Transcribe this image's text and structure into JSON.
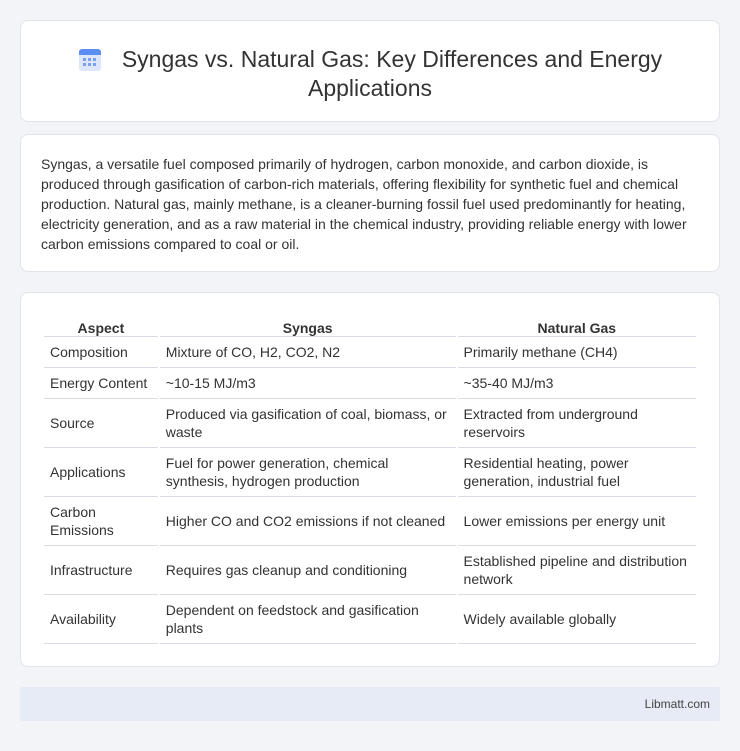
{
  "header": {
    "icon": "calendar-icon",
    "title": "Syngas vs. Natural Gas: Key Differences and Energy Applications"
  },
  "summary": {
    "text": "Syngas, a versatile fuel composed primarily of hydrogen, carbon monoxide, and carbon dioxide, is produced through gasification of carbon-rich materials, offering flexibility for synthetic fuel and chemical production. Natural gas, mainly methane, is a cleaner-burning fossil fuel used predominantly for heating, electricity generation, and as a raw material in the chemical industry, providing reliable energy with lower carbon emissions compared to coal or oil."
  },
  "table": {
    "headers": [
      "Aspect",
      "Syngas",
      "Natural Gas"
    ],
    "rows": [
      [
        "Composition",
        "Mixture of CO, H2, CO2, N2",
        "Primarily methane (CH4)"
      ],
      [
        "Energy Content",
        "~10-15 MJ/m3",
        "~35-40 MJ/m3"
      ],
      [
        "Source",
        "Produced via gasification of coal, biomass, or waste",
        "Extracted from underground reservoirs"
      ],
      [
        "Applications",
        "Fuel for power generation, chemical synthesis, hydrogen production",
        "Residential heating, power generation, industrial fuel"
      ],
      [
        "Carbon Emissions",
        "Higher CO and CO2 emissions if not cleaned",
        "Lower emissions per energy unit"
      ],
      [
        "Infrastructure",
        "Requires gas cleanup and conditioning",
        "Established pipeline and distribution network"
      ],
      [
        "Availability",
        "Dependent on feedstock and gasification plants",
        "Widely available globally"
      ]
    ]
  },
  "footer": {
    "brand": "Libmatt.com"
  },
  "colors": {
    "background": "#f3f4f8",
    "card": "#ffffff",
    "accent": "#5b8ef0",
    "footer": "#e6ebf5"
  }
}
